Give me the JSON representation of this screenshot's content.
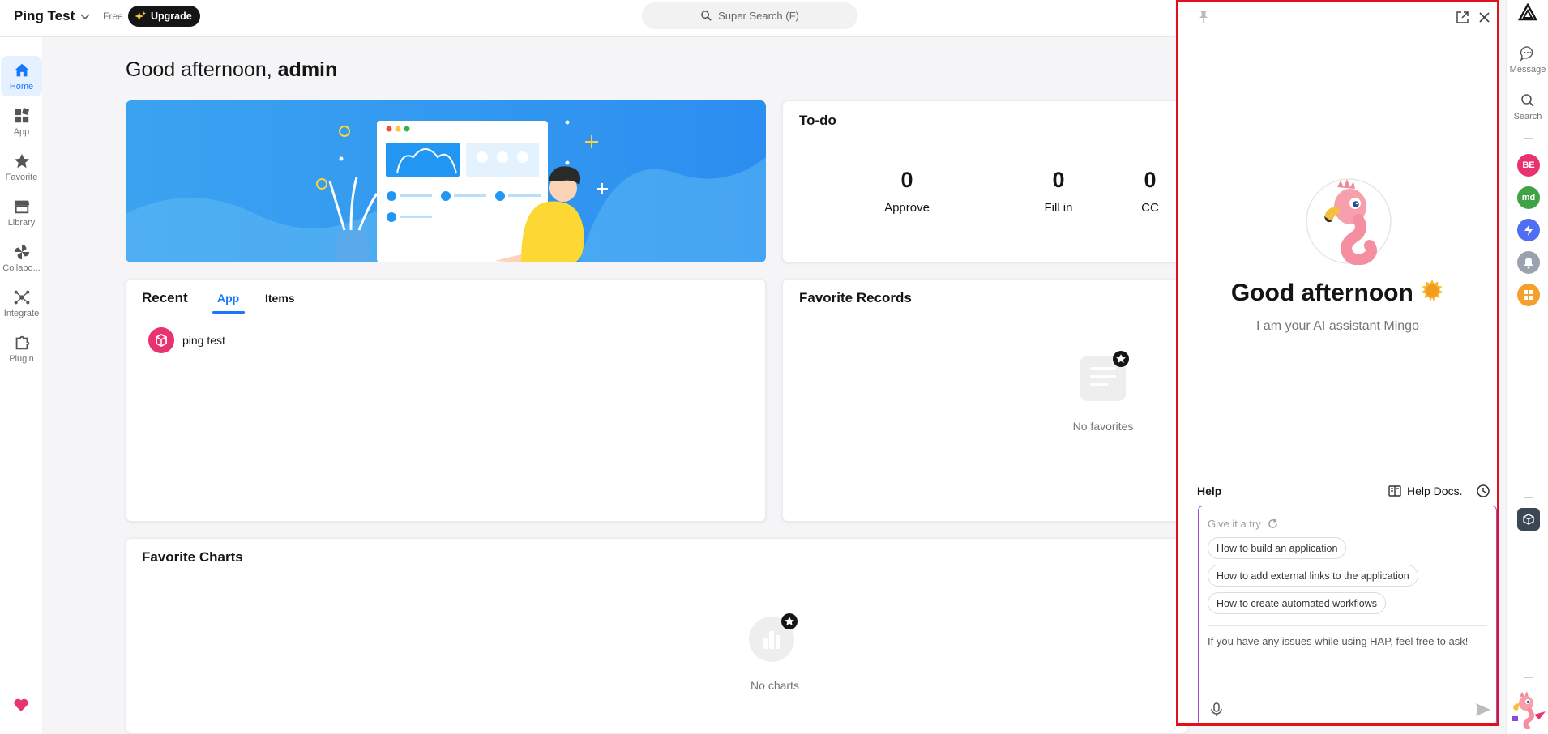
{
  "topbar": {
    "org_name": "Ping Test",
    "plan": "Free",
    "upgrade_label": "Upgrade",
    "search_placeholder": "Super Search (F)"
  },
  "nav": {
    "items": [
      {
        "label": "Home",
        "icon": "home-icon",
        "active": true
      },
      {
        "label": "App",
        "icon": "app-grid-icon"
      },
      {
        "label": "Favorite",
        "icon": "star-icon"
      },
      {
        "label": "Library",
        "icon": "store-icon"
      },
      {
        "label": "Collabo...",
        "icon": "pinwheel-icon"
      },
      {
        "label": "Integrate",
        "icon": "integrate-icon"
      },
      {
        "label": "Plugin",
        "icon": "plugin-icon"
      }
    ]
  },
  "main": {
    "greeting_prefix": "Good afternoon, ",
    "greeting_user": "admin",
    "todo": {
      "title": "To-do",
      "stats": [
        {
          "value": "0",
          "label": "Approve"
        },
        {
          "value": "0",
          "label": "Fill in"
        },
        {
          "value": "0",
          "label": "CC"
        }
      ]
    },
    "recent": {
      "title": "Recent",
      "tabs": [
        "App",
        "Items"
      ],
      "items": [
        {
          "name": "ping test"
        }
      ]
    },
    "favorite_records": {
      "title": "Favorite Records",
      "empty": "No favorites"
    },
    "favorite_charts": {
      "title": "Favorite Charts",
      "empty": "No charts"
    }
  },
  "assistant": {
    "greeting": "Good afternoon",
    "subtitle": "I am your AI assistant Mingo",
    "help_title": "Help",
    "help_docs": "Help Docs.",
    "try_label": "Give it a try",
    "suggestions": [
      "How to build an application",
      "How to add external links to the application",
      "How to create automated workflows"
    ],
    "input_placeholder": "If you have any issues while using HAP, feel free to ask!"
  },
  "rail": {
    "message_label": "Message",
    "search_label": "Search",
    "avatars": [
      {
        "text": "BE",
        "color": "#e8336f"
      },
      {
        "text": "md",
        "color": "#3fa244"
      }
    ]
  },
  "colors": {
    "accent": "#1677ff",
    "highlight_border": "#e0101d",
    "chat_border": "#a04ed6"
  }
}
